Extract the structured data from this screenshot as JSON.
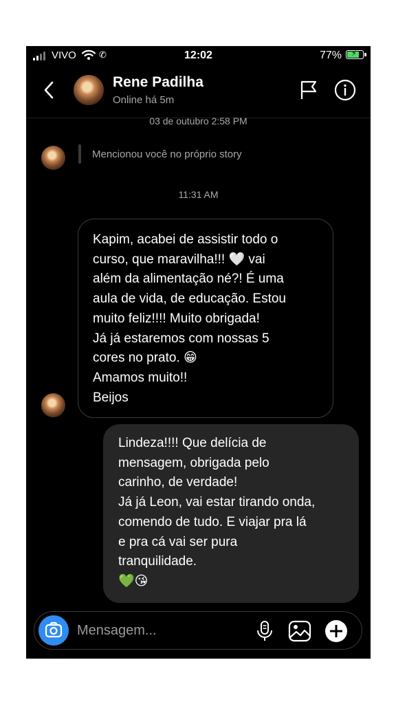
{
  "status_bar": {
    "carrier": "VIVO",
    "time": "12:02",
    "battery": "77%",
    "battery_level": 0.77
  },
  "header": {
    "name": "Rene Padilha",
    "status": "Online há 5m"
  },
  "conversation": {
    "timestamp_1": "03 de outubro 2:58 PM",
    "story_mention": "Mencionou você no próprio story",
    "timestamp_2": "11:31 AM",
    "received_lines": [
      "Kapim, acabei de assistir todo o",
      "curso, que maravilha!!! 🤍 vai",
      "além da alimentação né?! É uma",
      "aula de vida, de educação.  Estou",
      "muito feliz!!!! Muito obrigada!",
      "Já já estaremos com nossas 5",
      "cores no prato. 😁",
      "Amamos muito!!",
      "Beijos"
    ],
    "sent_lines": [
      "Lindeza!!!! Que delícia de",
      "mensagem, obrigada pelo",
      "carinho, de verdade!",
      "Já já Leon, vai estar tirando onda,",
      "comendo de tudo. E viajar pra lá",
      "e pra cá vai ser pura",
      "tranquilidade.",
      "💚😘"
    ]
  },
  "composer": {
    "placeholder": "Mensagem..."
  },
  "icons": {
    "back": "chevron-left-icon",
    "flag": "flag-icon",
    "info": "info-icon",
    "camera": "camera-icon",
    "mic": "microphone-icon",
    "gallery": "gallery-icon",
    "plus": "plus-icon"
  },
  "colors": {
    "background": "#000000",
    "sent_bubble": "#262626",
    "received_border": "#3a3a3a",
    "camera_button": "#2f8cf0",
    "battery_fill": "#4cd964"
  }
}
